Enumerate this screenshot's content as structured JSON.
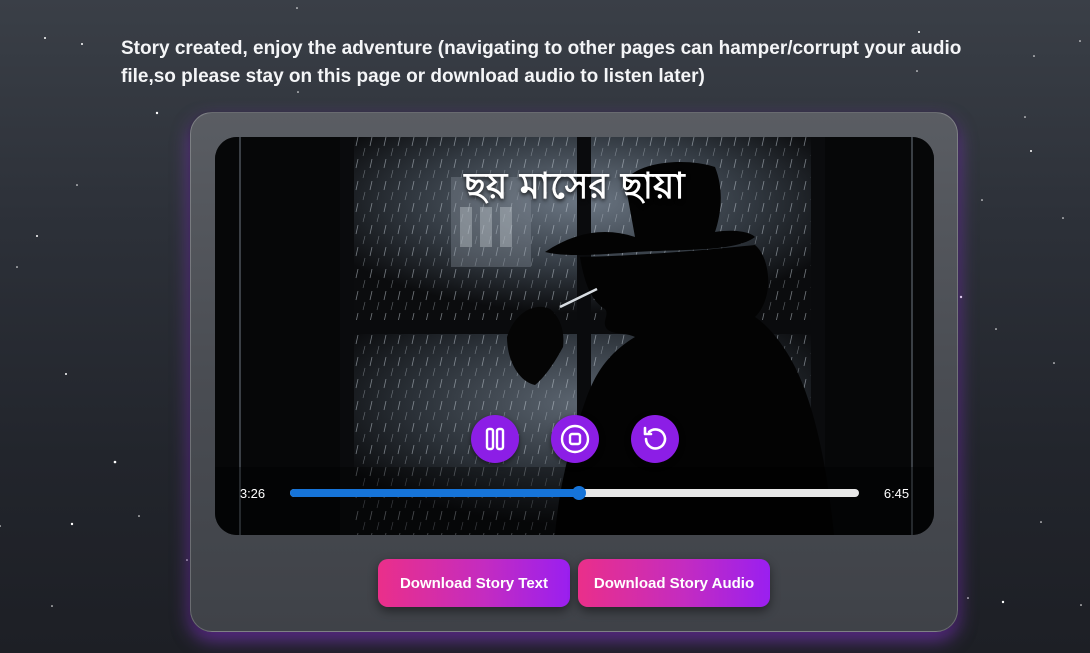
{
  "message": "Story created, enjoy the adventure (navigating to other pages can hamper/corrupt your audio file,so please stay on this page or download audio to listen later)",
  "player": {
    "title": "ছয় মাসের ছায়া",
    "current_time": "3:26",
    "total_time": "6:45",
    "progress_fraction": 0.508,
    "controls": [
      {
        "name": "pause-button",
        "icon": "pause-icon"
      },
      {
        "name": "stop-button",
        "icon": "stop-icon"
      },
      {
        "name": "restart-button",
        "icon": "restart-icon"
      }
    ]
  },
  "downloads": {
    "text_label": "Download Story Text",
    "audio_label": "Download Story Audio"
  },
  "colors": {
    "accent_purple": "#8c1ee6",
    "progress_blue": "#1674d9",
    "gradient_pink": "#ea2f8a",
    "gradient_violet": "#9a1ff0"
  }
}
